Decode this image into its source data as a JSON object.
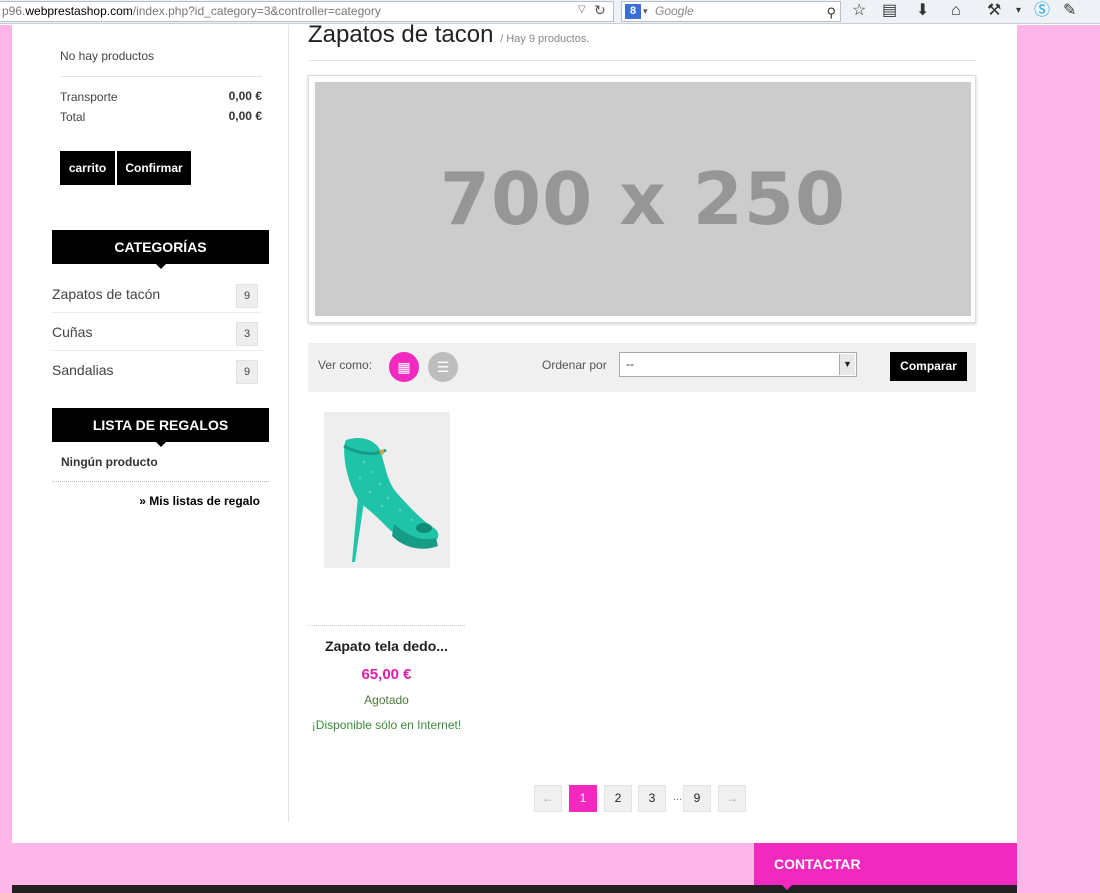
{
  "browser": {
    "url_prefix": "p96.",
    "url_host": "webprestashop.com",
    "url_path": "/index.php?id_category=3&controller=category",
    "search_placeholder": "Google",
    "search_engine_letter": "8"
  },
  "cart": {
    "empty_text": "No hay productos",
    "shipping_label": "Transporte",
    "shipping_value": "0,00 €",
    "total_label": "Total",
    "total_value": "0,00 €",
    "cart_button": "carrito",
    "confirm_button": "Confirmar"
  },
  "categories": {
    "title": "CATEGORÍAS",
    "items": [
      {
        "name": "Zapatos de tacón",
        "count": "9"
      },
      {
        "name": "Cuñas",
        "count": "3"
      },
      {
        "name": "Sandalias",
        "count": "9"
      }
    ]
  },
  "gift_list": {
    "title": "LISTA DE REGALOS",
    "empty_text": "Ningún producto",
    "link": "» Mis listas de regalo"
  },
  "category_header": {
    "title": "Zapatos de tacon",
    "subtitle": "/ Hay 9 productos."
  },
  "banner": {
    "text": "700 x 250"
  },
  "toolbar": {
    "view_label": "Ver como:",
    "sort_label": "Ordenar por",
    "sort_value": "--",
    "compare_button": "Comparar"
  },
  "product": {
    "name": "Zapato tela dedo...",
    "price": "65,00 €",
    "availability": "Agotado",
    "online_only": "¡Disponible sólo en Internet!"
  },
  "pagination": {
    "prev": "←",
    "pages": [
      "1",
      "2",
      "3",
      "9"
    ],
    "ellipsis": "...",
    "next": "→",
    "active_page": "1"
  },
  "footer": {
    "contact": "CONTACTAR"
  },
  "colors": {
    "accent": "#f129be",
    "page_background": "#fcb7e8",
    "price": "#e01da7"
  }
}
